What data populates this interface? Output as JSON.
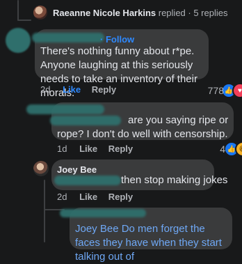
{
  "top_reply": {
    "name": "Raeanne Nicole Harkins",
    "suffix": "replied · 5 replies"
  },
  "comment1": {
    "follow_label": "Follow",
    "text": "There's nothing funny about r*pe. Anyone laughing at this seriously needs to take an inventory of their morals.",
    "time": "2d",
    "like": "Like",
    "reply": "Reply",
    "reaction_count": "778"
  },
  "comment2": {
    "text": "are you saying ripe or rope? I don't do well with censorship.",
    "time": "1d",
    "like": "Like",
    "reply": "Reply",
    "reaction_count": "4"
  },
  "comment3": {
    "name": "Joey Bee",
    "text": "then stop making jokes",
    "time": "2d",
    "like": "Like",
    "reply": "Reply"
  },
  "comment4": {
    "text": "Joey Bee Do men forget the faces they have when they start talking out of"
  },
  "colors": {
    "background": "#18191a",
    "bubble": "#3a3b3c",
    "accent": "#2e89ff",
    "redaction": "#2f6f6c"
  }
}
